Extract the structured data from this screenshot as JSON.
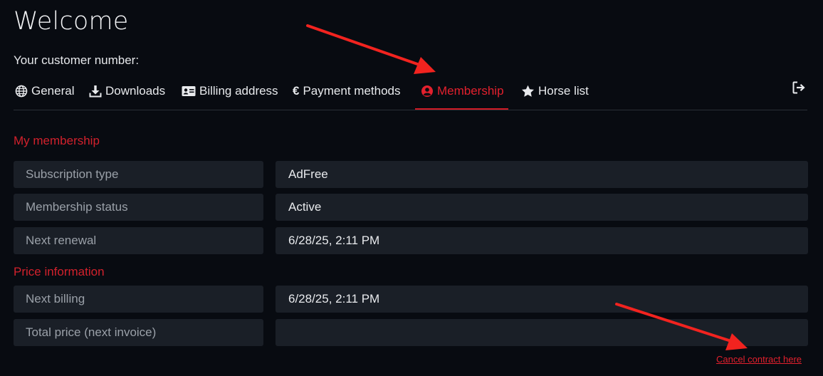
{
  "page": {
    "title": "Welcome",
    "customer_label": "Your customer number:"
  },
  "tabs": [
    {
      "label": "General",
      "icon": "globe-icon"
    },
    {
      "label": "Downloads",
      "icon": "download-icon"
    },
    {
      "label": "Billing address",
      "icon": "id-card-icon"
    },
    {
      "label": "Payment methods",
      "icon": "euro-icon"
    },
    {
      "label": "Membership",
      "icon": "user-circle-icon",
      "active": true
    },
    {
      "label": "Horse list",
      "icon": "star-icon"
    }
  ],
  "logout_icon": "logout-icon",
  "membership": {
    "heading": "My membership",
    "rows": [
      {
        "label": "Subscription type",
        "value": "AdFree"
      },
      {
        "label": "Membership status",
        "value": "Active"
      },
      {
        "label": "Next renewal",
        "value": "6/28/25, 2:11 PM"
      }
    ]
  },
  "price": {
    "heading": "Price information",
    "rows": [
      {
        "label": "Next billing",
        "value": "6/28/25, 2:11 PM"
      },
      {
        "label": "Total price (next invoice)",
        "value": ""
      }
    ]
  },
  "cancel_link": "Cancel contract here",
  "colors": {
    "background": "#080b11",
    "accent": "#e3202d",
    "field": "#1a1f27",
    "annotation_arrow": "#f2231f"
  }
}
